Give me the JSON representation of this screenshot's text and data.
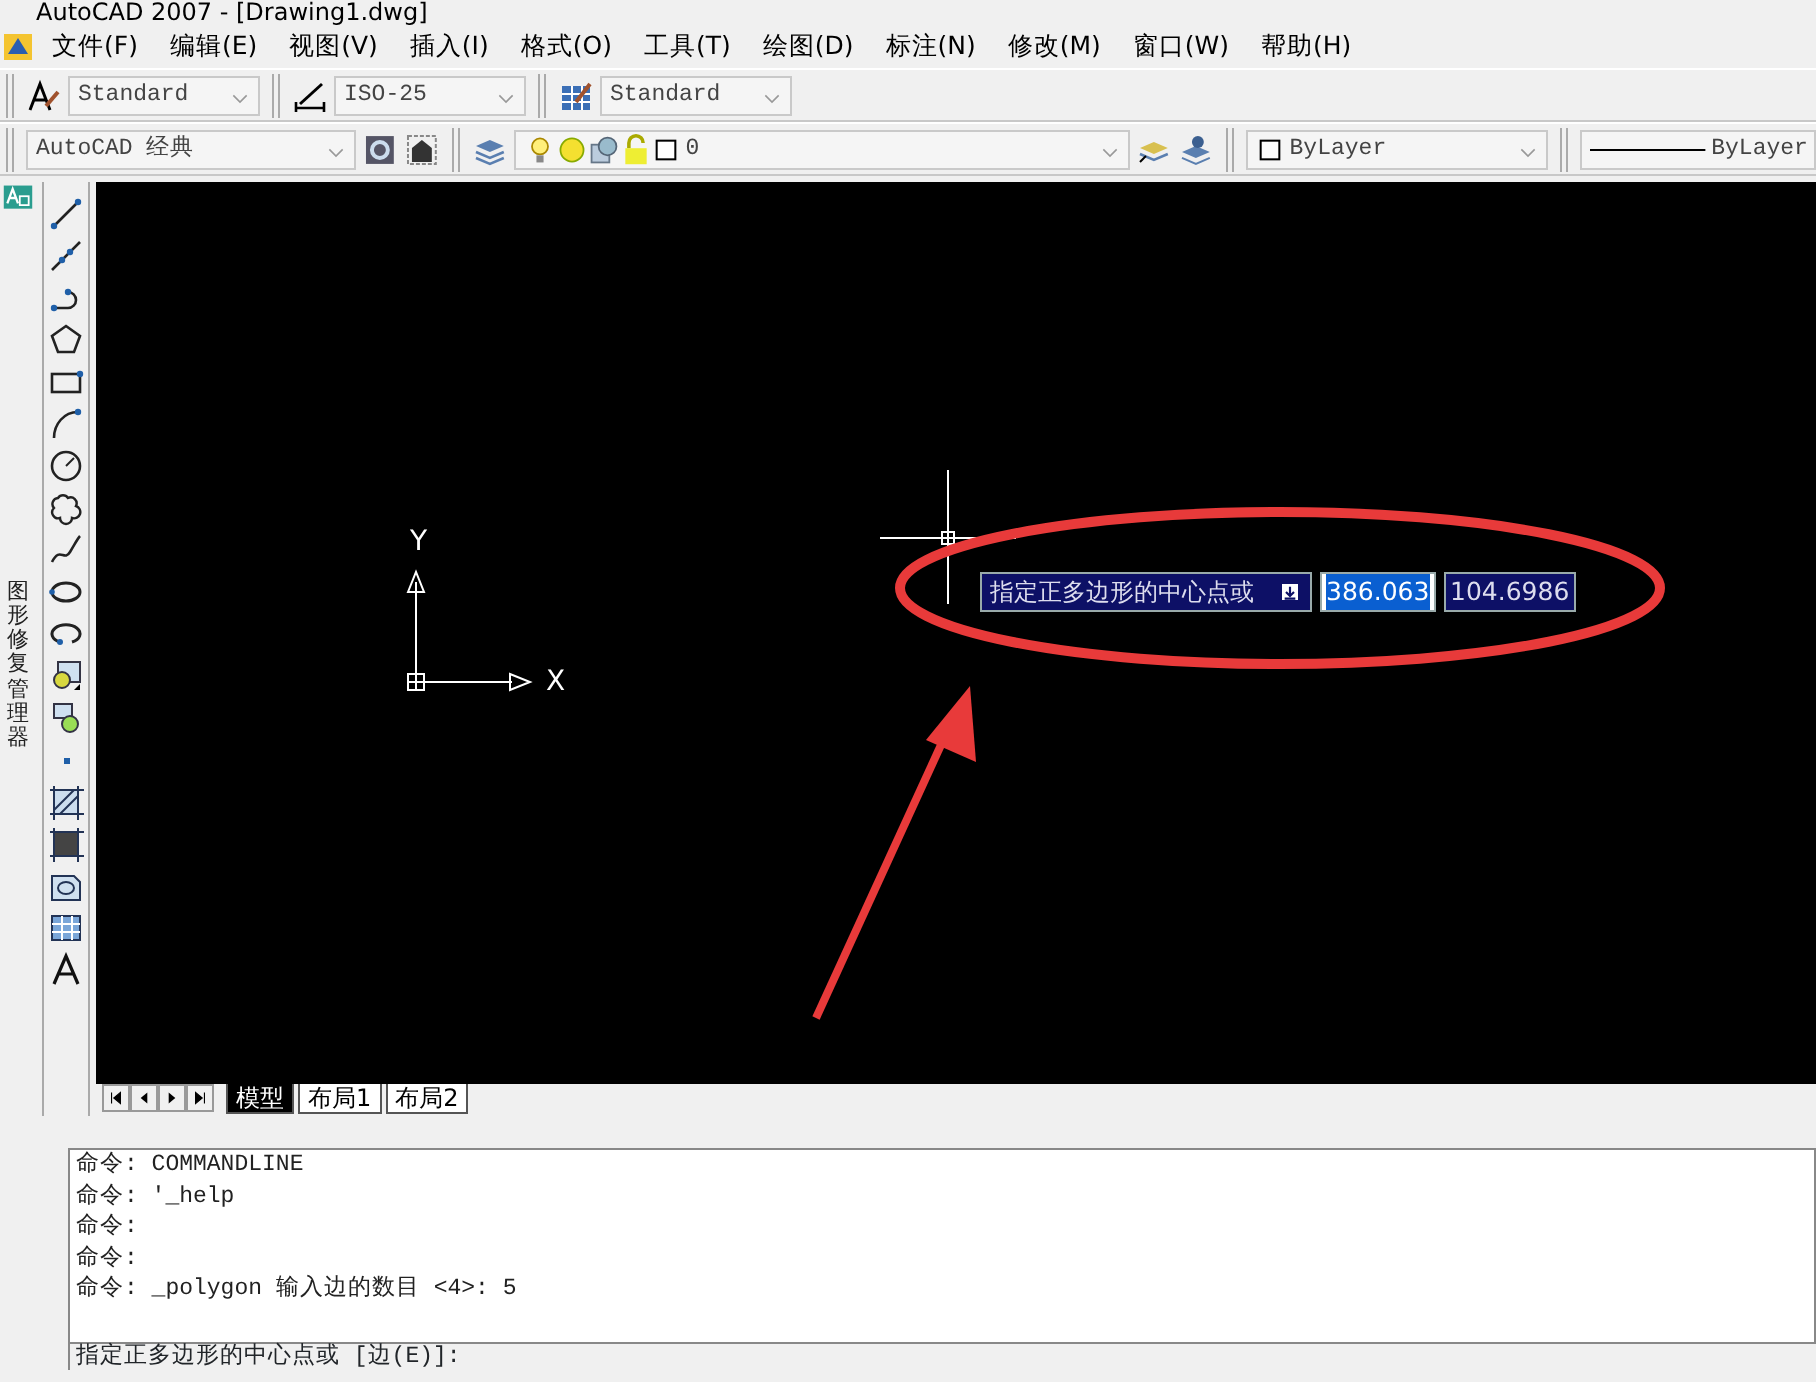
{
  "window": {
    "title": "AutoCAD 2007 - [Drawing1.dwg]"
  },
  "menu": [
    "文件(F)",
    "编辑(E)",
    "视图(V)",
    "插入(I)",
    "格式(O)",
    "工具(T)",
    "绘图(D)",
    "标注(N)",
    "修改(M)",
    "窗口(W)",
    "帮助(H)"
  ],
  "styles_toolbar": {
    "text_style": "Standard",
    "dim_style": "ISO-25",
    "table_style": "Standard"
  },
  "properties_toolbar": {
    "workspace": "AutoCAD 经典",
    "layer": "0",
    "color_control": "ByLayer",
    "linetype": "ByLayer"
  },
  "side_panel": {
    "title": "图形修复管理器"
  },
  "canvas": {
    "ucs_x_label": "X",
    "ucs_y_label": "Y",
    "dynamic_input": {
      "prompt": "指定正多边形的中心点或",
      "x_value": "386.063",
      "y_value": "104.6986"
    }
  },
  "layout_tabs": [
    {
      "label": "模型",
      "selected": true
    },
    {
      "label": "布局1",
      "selected": false
    },
    {
      "label": "布局2",
      "selected": false
    }
  ],
  "command_history": [
    "命令: COMMANDLINE",
    "命令: '_help",
    "命令:",
    "命令:",
    "命令: _polygon 输入边的数目 <4>: 5"
  ],
  "command_prompt": "指定正多边形的中心点或 [边(E)]:"
}
